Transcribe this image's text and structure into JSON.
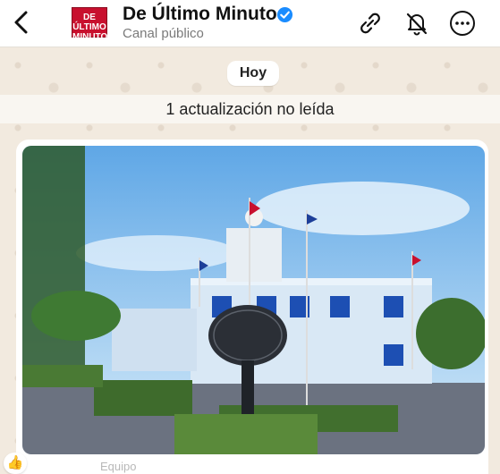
{
  "header": {
    "back_icon": "back-arrow-icon",
    "channel_name": "De Último Minuto",
    "channel_type": "Canal público",
    "logo_line1": "DE ÚLTIMO",
    "logo_line2": "MINUTO",
    "brand_color": "#c8102e",
    "verified_color": "#1a8cff",
    "actions": [
      "link-icon",
      "mute-bell-icon",
      "more-options-icon"
    ]
  },
  "chat": {
    "day_label": "Hoy",
    "unread_label": "1 actualización no leída",
    "reaction": "👍",
    "caption_partial": "Equipo"
  }
}
